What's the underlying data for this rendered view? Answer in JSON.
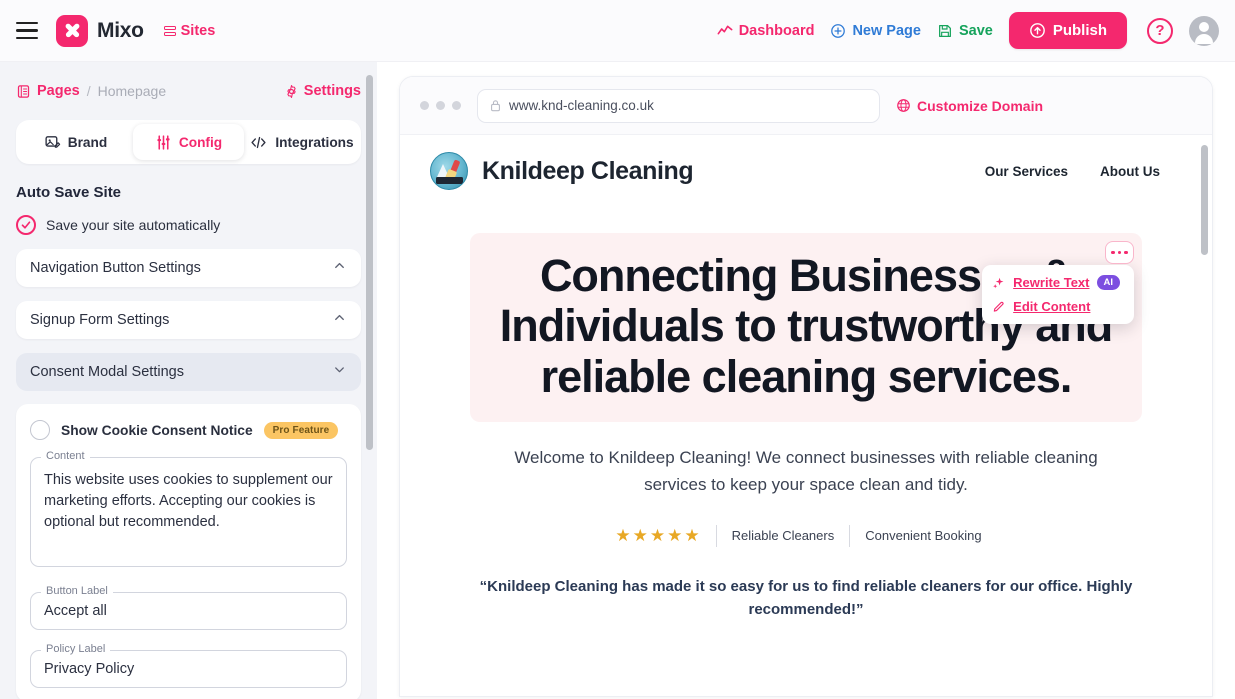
{
  "topbar": {
    "menu_icon": "hamburger-icon",
    "brand_name": "Mixo",
    "sites_label": "Sites",
    "dashboard_label": "Dashboard",
    "new_page_label": "New Page",
    "save_label": "Save",
    "publish_label": "Publish",
    "help_label": "?",
    "accent": "#f4286e",
    "new_page_color": "#2f7bd6",
    "save_color": "#16a35c"
  },
  "sidebar": {
    "breadcrumb": {
      "root": "Pages",
      "separator": "/",
      "current": "Homepage"
    },
    "settings_label": "Settings",
    "tabs": [
      {
        "label": "Brand",
        "icon": "image-edit-icon",
        "active": false
      },
      {
        "label": "Config",
        "icon": "sliders-icon",
        "active": true
      },
      {
        "label": "Integrations",
        "icon": "code-icon",
        "active": false
      }
    ],
    "autosave": {
      "title": "Auto Save Site",
      "checkbox_label": "Save your site automatically",
      "checked": true
    },
    "accordions": [
      {
        "label": "Navigation Button Settings",
        "state": "collapsed",
        "chevron": "chevron-up-icon"
      },
      {
        "label": "Signup Form Settings",
        "state": "collapsed",
        "chevron": "chevron-up-icon"
      },
      {
        "label": "Consent Modal Settings",
        "state": "expanded",
        "chevron": "chevron-down-icon"
      }
    ],
    "consent": {
      "toggle_label": "Show Cookie Consent Notice",
      "toggle_checked": false,
      "pro_badge": "Pro Feature",
      "content_legend": "Content",
      "content_value": "This website uses cookies to supplement our marketing efforts. Accepting our cookies is optional but recommended.",
      "button_legend": "Button Label",
      "button_value": "Accept all",
      "policy_legend": "Policy Label",
      "policy_value": "Privacy Policy"
    }
  },
  "preview": {
    "url": "www.knd-cleaning.co.uk",
    "customize_domain_label": "Customize Domain",
    "site": {
      "title": "Knildeep Cleaning",
      "nav": [
        "Our Services",
        "About Us"
      ],
      "hero_heading": "Connecting Businesses & Individuals to trustworthy and reliable cleaning services.",
      "hero_sub": "Welcome to Knildeep Cleaning! We connect businesses with reliable cleaning services to keep your space clean and tidy.",
      "stars": "★★★★★",
      "stats": [
        "Reliable Cleaners",
        "Convenient Booking"
      ],
      "quote": "“Knildeep Cleaning has made it so easy for us to find reliable cleaners for our office. Highly recommended!”"
    },
    "edit_menu": {
      "rewrite_label": "Rewrite Text",
      "ai_badge": "AI",
      "edit_label": "Edit Content"
    }
  }
}
